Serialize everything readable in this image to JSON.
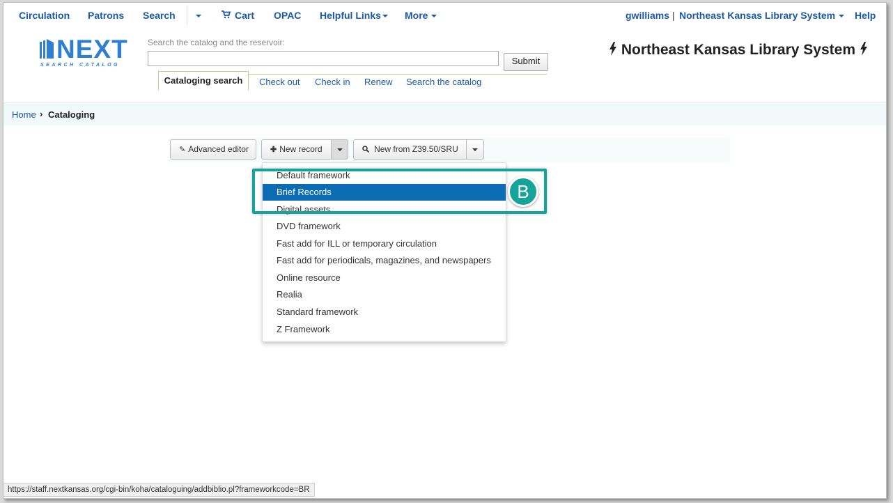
{
  "nav": {
    "circulation": "Circulation",
    "patrons": "Patrons",
    "search": "Search",
    "cart": "Cart",
    "opac": "OPAC",
    "helpful_links": "Helpful Links",
    "more": "More",
    "user": "gwilliams",
    "separator": "|",
    "library": "Northeast Kansas Library System",
    "help": "Help"
  },
  "logo": {
    "main": "NEXT",
    "sub": "SEARCH CATALOG"
  },
  "search": {
    "label": "Search the catalog and the reservoir:",
    "value": "",
    "submit": "Submit"
  },
  "tabs": [
    "Cataloging search",
    "Check out",
    "Check in",
    "Renew",
    "Search the catalog"
  ],
  "library_title": "Northeast Kansas Library System",
  "breadcrumb": {
    "home": "Home",
    "sep": "›",
    "current": "Cataloging"
  },
  "toolbar": {
    "advanced_editor": "Advanced editor",
    "new_record": "New record",
    "new_from_z3950": "New from Z39.50/SRU"
  },
  "menu_items": [
    "Default framework",
    "Brief Records",
    "Digital assets",
    "DVD framework",
    "Fast add for ILL or temporary circulation",
    "Fast add for periodicals, magazines, and newspapers",
    "Online resource",
    "Realia",
    "Standard framework",
    "Z Framework"
  ],
  "active_menu_index": 1,
  "annotation_badge": "B",
  "status_url": "https://staff.nextkansas.org/cgi-bin/koha/cataloguing/addbiblio.pl?frameworkcode=BR",
  "colors": {
    "link": "#1a5aa6",
    "highlight": "#17a39a",
    "menu_active": "#0b6cb3"
  }
}
